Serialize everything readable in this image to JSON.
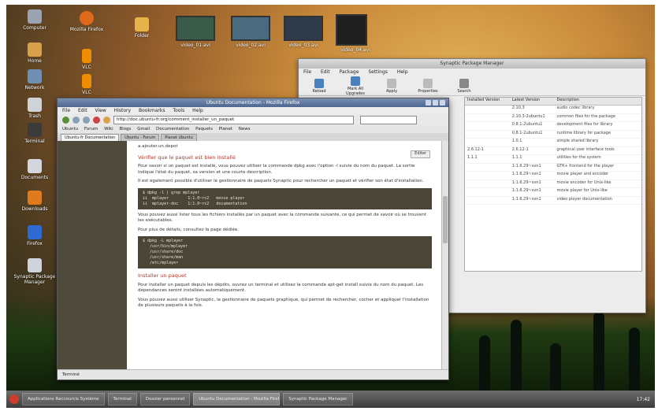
{
  "desktop": {
    "icons": [
      {
        "label": "Computer",
        "color": "#9aa4b0"
      },
      {
        "label": "Home",
        "color": "#d7a04a"
      },
      {
        "label": "Network",
        "color": "#6f8fb5"
      },
      {
        "label": "Trash",
        "color": "#cfd3d8"
      },
      {
        "label": "Terminal",
        "color": "#3b3b3b"
      },
      {
        "label": "Documents",
        "color": "#d3d7dd"
      },
      {
        "label": "Downloads",
        "color": "#e07a1f"
      },
      {
        "label": "Firefox",
        "color": "#2e6bd1"
      },
      {
        "label": "Synaptic Package Manager",
        "color": "#cfd3da"
      }
    ],
    "top_icons": [
      {
        "label": "Mozilla Firefox",
        "color": "#e06a1c"
      },
      {
        "label": "VLC",
        "color": "#f08c00"
      },
      {
        "label": "VLC",
        "color": "#f08c00"
      },
      {
        "label": "Folder",
        "color": "#e6b24a"
      }
    ],
    "thumbnails": [
      {
        "label": "video_01.avi"
      },
      {
        "label": "video_02.avi"
      },
      {
        "label": "video_03.avi"
      },
      {
        "label": "video_04.avi"
      }
    ]
  },
  "synaptic": {
    "title": "Synaptic Package Manager",
    "menu": [
      "File",
      "Edit",
      "Package",
      "Settings",
      "Help"
    ],
    "toolbar": [
      "Reload",
      "Mark All Upgrades",
      "Apply",
      "Properties",
      "Search"
    ],
    "columns": [
      "Installed Version",
      "Latest Version",
      "Description"
    ],
    "rows": [
      [
        "",
        "2.10.3",
        "audio codec library"
      ],
      [
        "",
        "2.10.3-2ubuntu1",
        "common files for the package"
      ],
      [
        "",
        "0.8.1-2ubuntu1",
        "development files for library"
      ],
      [
        "",
        "0.8.1-2ubuntu1",
        "runtime library for package"
      ],
      [
        "",
        "1.0.1",
        "simple shared library"
      ],
      [
        "2.6.12-1",
        "2.6.12-1",
        "graphical user interface tools"
      ],
      [
        "1.1.1",
        "1.1.1",
        "utilities for the system"
      ],
      [
        "",
        "1:1.6.29~svn1",
        "GTK+ frontend for the player"
      ],
      [
        "",
        "1:1.6.29~svn1",
        "movie player and encoder"
      ],
      [
        "",
        "1:1.6.29~svn1",
        "movie encoder for Unix-like"
      ],
      [
        "",
        "1:1.6.29~svn1",
        "movie player for Unix-like"
      ],
      [
        "",
        "1:1.6.29~svn1",
        "video player documentation"
      ]
    ]
  },
  "firefox": {
    "title": "Ubuntu Documentation - Mozilla Firefox",
    "menu": [
      "File",
      "Edit",
      "View",
      "History",
      "Bookmarks",
      "Tools",
      "Help"
    ],
    "url": "http://doc.ubuntu-fr.org/comment_installer_un_paquet",
    "bookmarks": [
      "Ubuntu",
      "Forum",
      "Wiki",
      "Blogs",
      "Gmail",
      "Documentation",
      "Paquets",
      "Planet",
      "News"
    ],
    "tabs": [
      {
        "label": "Ubuntu-fr Documentation",
        "active": true
      },
      {
        "label": "Ubuntu - Forum",
        "active": false
      },
      {
        "label": "Planet Ubuntu",
        "active": false
      }
    ],
    "content": {
      "top_link": "a.ajouter.un.depot",
      "button_label": "Editer",
      "heading1": "Vérifier que le paquet est bien installé",
      "para1": "Pour savoir si un paquet est installé, vous pouvez utiliser la commande dpkg avec l'option -l suivie du nom du paquet. La sortie indique l'état du paquet, sa version et une courte description.",
      "para2": "Il est également possible d'utiliser le gestionnaire de paquets Synaptic pour rechercher un paquet et vérifier son état d'installation.",
      "code1": [
        "$ dpkg -l | grep mplayer",
        "ii  mplayer        1:1.0~rc2   movie player",
        "ii  mplayer-doc    1:1.0~rc2   documentation"
      ],
      "para3": "Vous pouvez aussi lister tous les fichiers installés par un paquet avec la commande suivante, ce qui permet de savoir où se trouvent les exécutables.",
      "para4": "Pour plus de détails, consultez la page dédiée.",
      "code2": [
        "$ dpkg -L mplayer",
        "   /usr/bin/mplayer",
        "   /usr/share/doc",
        "   /usr/share/man",
        "   /etc/mplayer"
      ],
      "heading2": "Installer un paquet",
      "para5": "Pour installer un paquet depuis les dépôts, ouvrez un terminal et utilisez la commande apt-get install suivie du nom du paquet. Les dépendances seront installées automatiquement.",
      "para6": "Vous pouvez aussi utiliser Synaptic, le gestionnaire de paquets graphique, qui permet de rechercher, cocher et appliquer l'installation de plusieurs paquets à la fois."
    },
    "status": "Terminé"
  },
  "taskbar": {
    "items": [
      {
        "label": "Applications Raccourcis Système",
        "active": false
      },
      {
        "label": "Terminal",
        "active": false
      },
      {
        "label": "Dossier personnel",
        "active": false
      },
      {
        "label": "Ubuntu Documentation - Mozilla Firefox",
        "active": true
      },
      {
        "label": "Synaptic Package Manager",
        "active": false
      }
    ],
    "clock": "17:42"
  }
}
